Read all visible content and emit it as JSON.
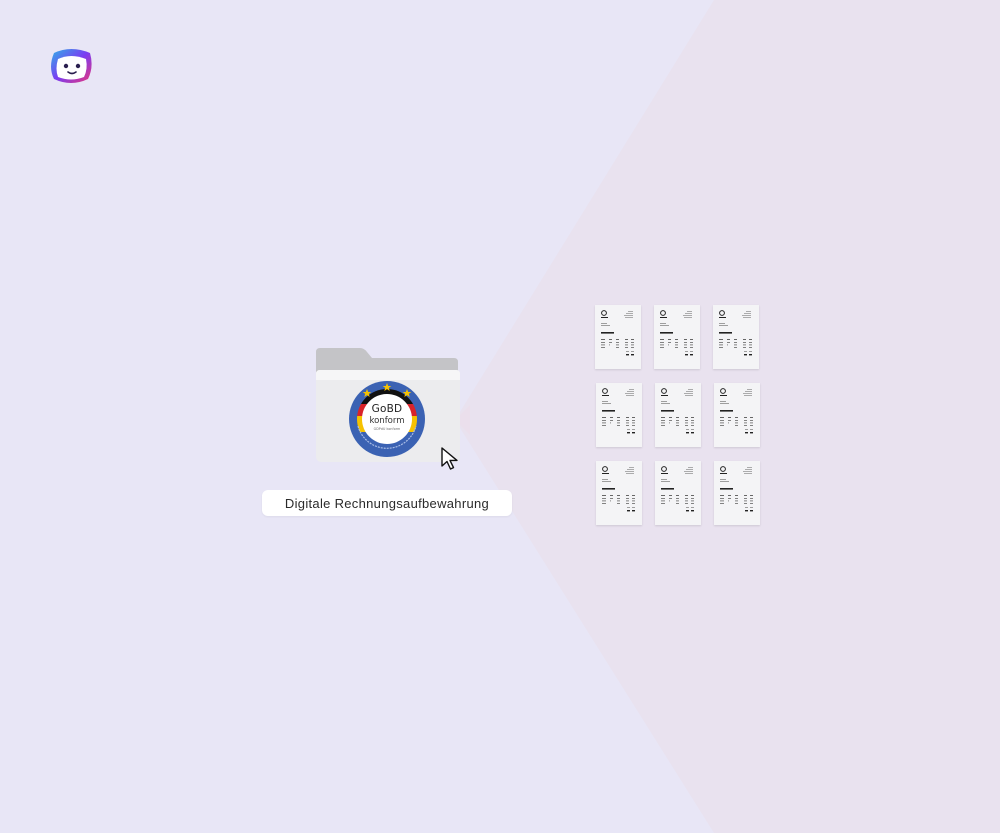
{
  "brand": {
    "logo_icon": "mascot-logo-icon",
    "colors": [
      "#7a3df2",
      "#e8357a",
      "#2fb0e8"
    ]
  },
  "background": {
    "base": "#e8e6f6",
    "accent_wedge": "#e9e2ef"
  },
  "folder": {
    "icon": "folder-icon",
    "label": "Digitale Rechnungsaufbewahrung",
    "seal": {
      "icon": "gobd-seal-icon",
      "title": "GoBD",
      "subtitle": "konform",
      "small_text": "GDPdU konform",
      "colors": {
        "ring": "#3b62b3",
        "inner": "#ffffff",
        "stars": "#f6c200"
      }
    },
    "cursor_icon": "mouse-pointer-icon"
  },
  "invoices": {
    "count": 9,
    "icon": "invoice-document-icon"
  }
}
